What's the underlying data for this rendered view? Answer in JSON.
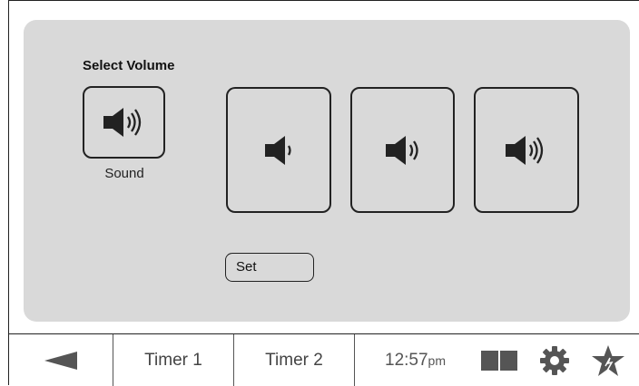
{
  "panel": {
    "heading": "Select Volume",
    "sound_label": "Sound",
    "set_label": "Set"
  },
  "bottom_bar": {
    "timer1_label": "Timer 1",
    "timer2_label": "Timer 2",
    "time": "12:57",
    "time_suffix": "pm"
  },
  "icons": {
    "back": "back-arrow-icon",
    "layout": "split-view-icon",
    "settings": "gear-icon",
    "favorite": "star-icon",
    "speaker": "speaker-icon"
  },
  "colors": {
    "panel_bg": "#d9d9d9",
    "icon": "#222222",
    "bar_icon": "#555555"
  }
}
